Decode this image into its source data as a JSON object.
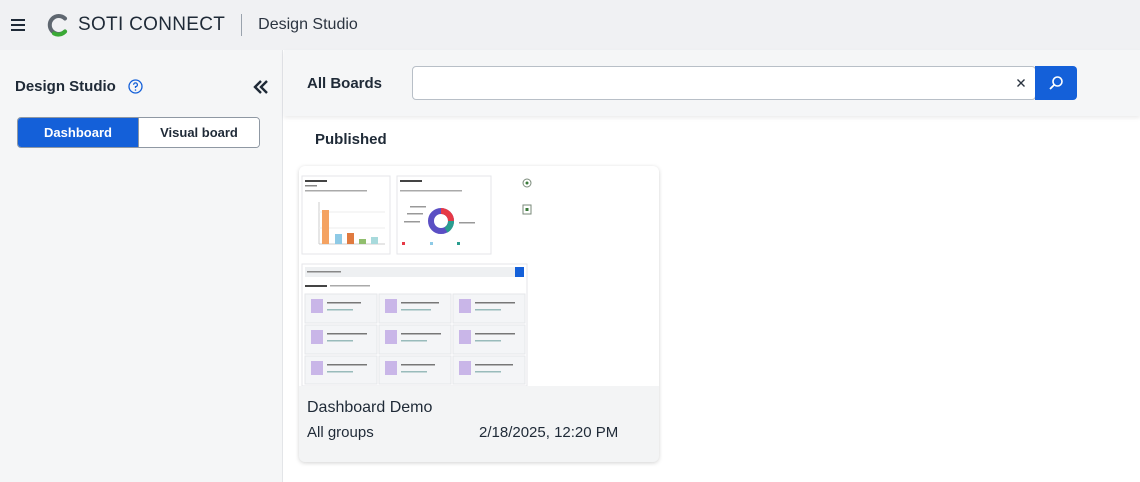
{
  "app": {
    "brand_name": "SOTI CONNECT",
    "section": "Design Studio",
    "brand_colors": {
      "logo_gray": "#5f6770",
      "logo_green": "#3aa935",
      "accent_blue": "#1460d9"
    }
  },
  "sidebar": {
    "title": "Design Studio",
    "toggle": {
      "dashboard_label": "Dashboard",
      "visual_board_label": "Visual board",
      "selected": "Dashboard"
    }
  },
  "main": {
    "title": "All Boards",
    "search": {
      "value": "",
      "placeholder": ""
    },
    "section_title": "Published",
    "boards": [
      {
        "name": "Dashboard Demo",
        "group": "All groups",
        "date": "2/18/2025, 12:20 PM"
      }
    ]
  }
}
